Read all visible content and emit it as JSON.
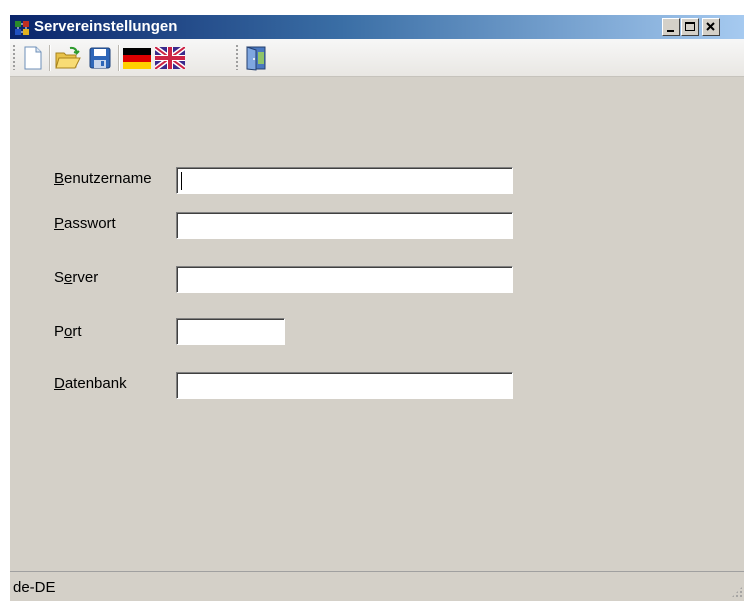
{
  "window": {
    "title": "Servereinstellungen",
    "buttons": {
      "minimize": "_",
      "maximize": "□",
      "close": "×"
    }
  },
  "toolbar": {
    "items": [
      {
        "name": "new-document-icon"
      },
      {
        "name": "open-folder-icon"
      },
      {
        "name": "save-disk-icon"
      },
      {
        "name": "german-flag-icon"
      },
      {
        "name": "uk-flag-icon"
      },
      {
        "name": "exit-door-icon"
      }
    ]
  },
  "form": {
    "username": {
      "mnemonic": "B",
      "rest": "enutzername",
      "value": ""
    },
    "password": {
      "mnemonic": "P",
      "rest": "asswort",
      "value": ""
    },
    "server": {
      "before": "S",
      "mnemonic": "e",
      "rest": "rver",
      "value": ""
    },
    "port": {
      "before": "P",
      "mnemonic": "o",
      "rest": "rt",
      "value": ""
    },
    "database": {
      "mnemonic": "D",
      "rest": "atenbank",
      "value": ""
    }
  },
  "status": {
    "locale": "de-DE"
  },
  "colors": {
    "face": "#d4d0c8",
    "title_start": "#0a246a",
    "title_end": "#a6caf0",
    "flag_de": [
      "#000000",
      "#dd0000",
      "#ffce00"
    ]
  }
}
